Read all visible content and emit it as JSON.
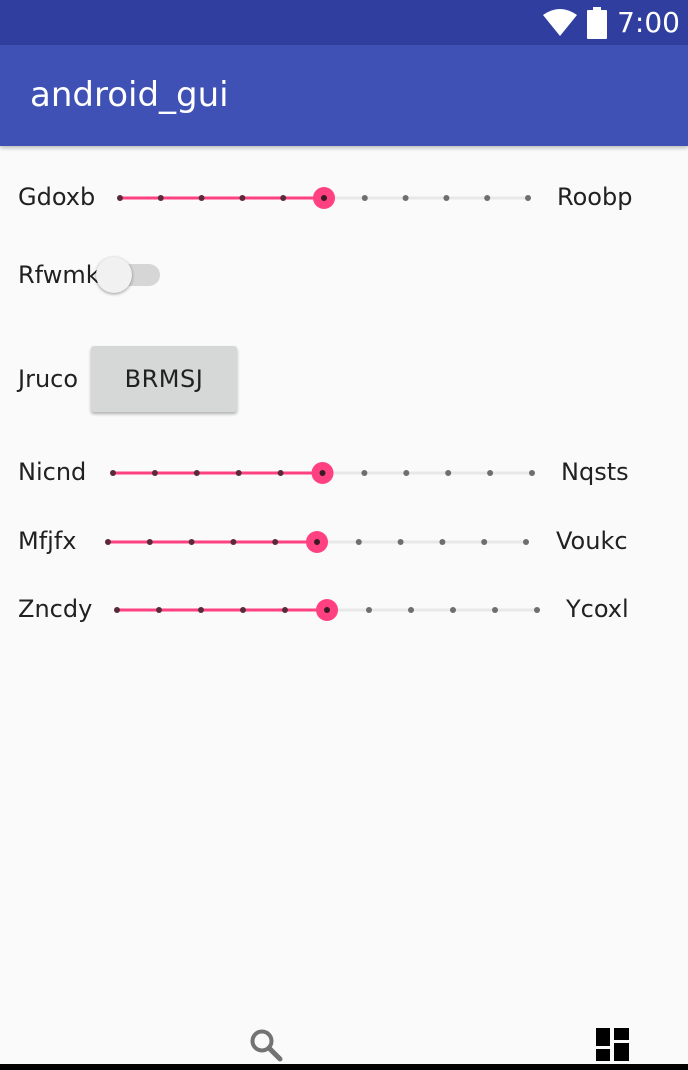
{
  "status_bar": {
    "time": "7:00"
  },
  "app_bar": {
    "title": "android_gui"
  },
  "colors": {
    "accent": "#ff4081",
    "primary": "#3f51b5",
    "primary_dark": "#303f9f"
  },
  "controls": {
    "slider1": {
      "label": "Gdoxb",
      "end_label": "Roobp",
      "value": 5,
      "max": 10
    },
    "switch1": {
      "label": "Rfwmk",
      "checked": false
    },
    "button1": {
      "label": "Jruco",
      "button_text": "BRMSJ"
    },
    "slider2": {
      "label": "Nicnd",
      "end_label": "Nqsts",
      "value": 5,
      "max": 10
    },
    "slider3": {
      "label": "Mfjfx",
      "end_label": "Voukc",
      "value": 5,
      "max": 10
    },
    "slider4": {
      "label": "Zncdy",
      "end_label": "Ycoxl",
      "value": 5,
      "max": 10
    }
  },
  "bottom_bar": {
    "icons": [
      "search-icon",
      "dashboard-icon"
    ]
  }
}
